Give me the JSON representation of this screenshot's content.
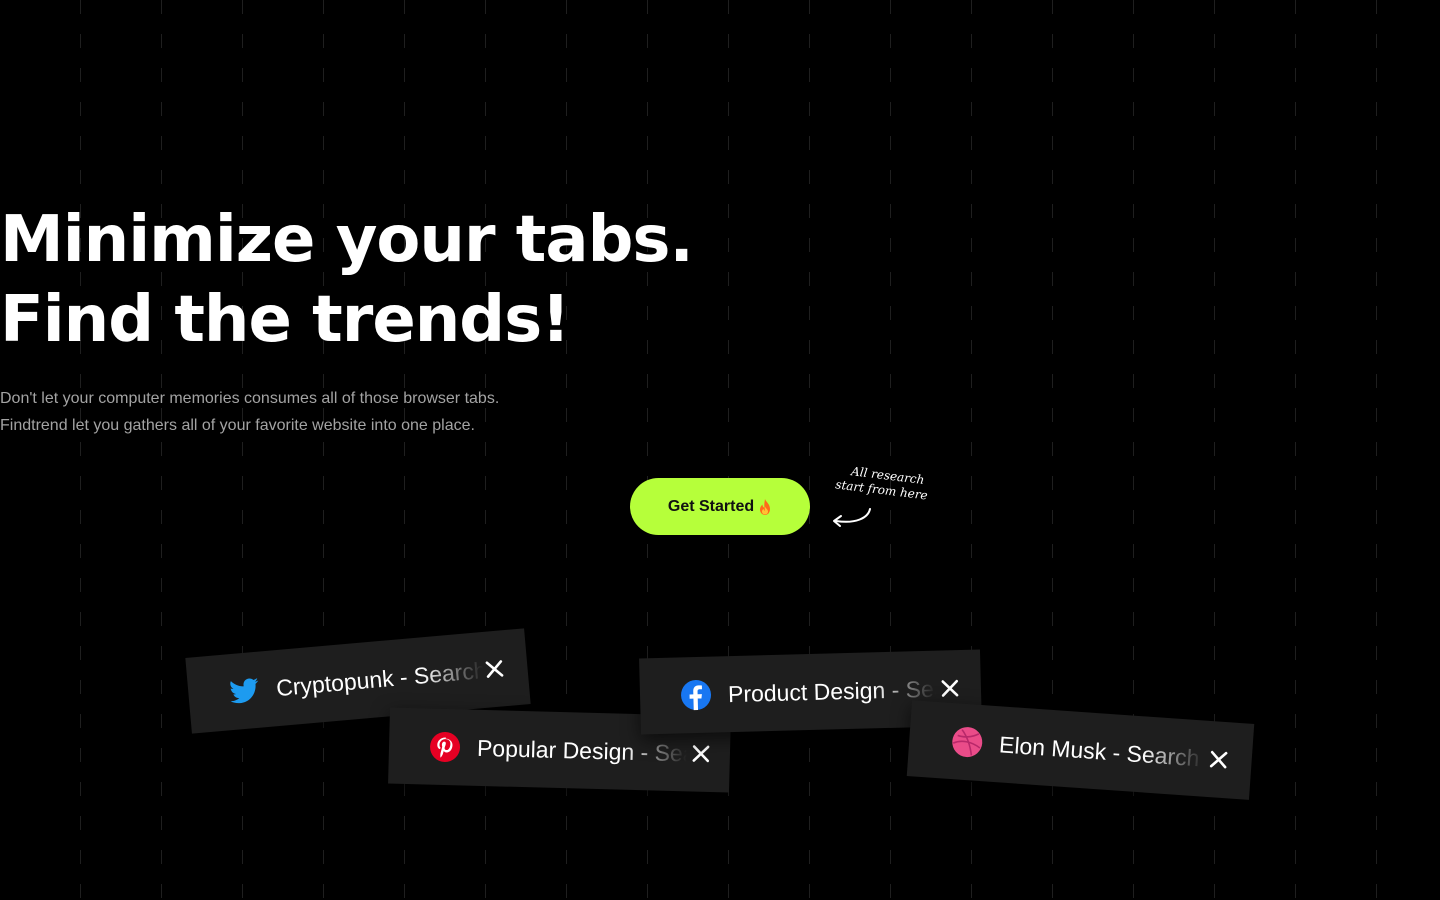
{
  "hero": {
    "headline_line1": "Minimize your tabs.",
    "headline_line2": "Find the trends!",
    "subtitle_line1": "Don't let your computer memories consumes all of those browser tabs.",
    "subtitle_line2": "Findtrend  let you gathers all of your favorite website into one place."
  },
  "cta": {
    "label": "Get Started",
    "icon": "fire-icon",
    "color": "#b6ff3a"
  },
  "annotation": {
    "line1": "All research",
    "line2": "start from here",
    "icon": "curved-arrow-icon"
  },
  "tabs": [
    {
      "label": "Cryptopunk - Search",
      "icon": "twitter-icon",
      "icon_color": "#1d9bf0",
      "close_icon": "close-icon"
    },
    {
      "label": "Popular Design - Search",
      "icon": "pinterest-icon",
      "icon_color": "#e60023",
      "close_icon": "close-icon"
    },
    {
      "label": "Product Design - Search",
      "icon": "facebook-icon",
      "icon_color": "#1877f2",
      "close_icon": "close-icon"
    },
    {
      "label": "Elon Musk - Search",
      "icon": "dribbble-icon",
      "icon_color": "#ea4c89",
      "close_icon": "close-icon"
    }
  ],
  "colors": {
    "background": "#000000",
    "tab_background": "#1e1e1e",
    "subtitle": "#a3a3a3"
  }
}
